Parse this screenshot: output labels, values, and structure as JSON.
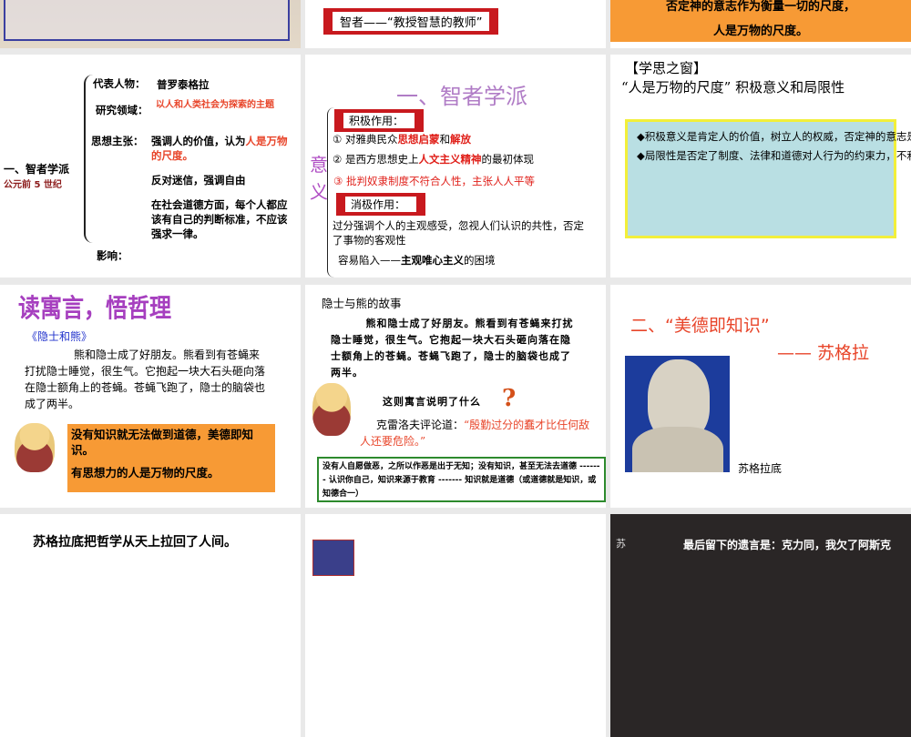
{
  "slides": {
    "s0": {
      "kind": "photo"
    },
    "s1": {
      "banner": "智者——“教授智慧的教师”"
    },
    "s2": {
      "line1": "否定神的意志作为衡量一切的尺度，",
      "line2": "人是万物的尺度。"
    },
    "s3": {
      "title": "一、智者学派",
      "era": "公元前 5 世纪",
      "rep_label": "代表人物：",
      "rep": "普罗泰格拉",
      "field_label": "研究领域：",
      "field": "以人和人类社会为探索的主题",
      "idea_label": "思想主张：",
      "idea1a": "强调人的价值，认为",
      "idea1b": "人是万物的尺度。",
      "idea2": "反对迷信，强调自由",
      "idea3": "在社会道德方面，每个人都应该有自己的判断标准，不应该强求一律。",
      "influence_label": "影响："
    },
    "s4": {
      "title": "一、智者学派",
      "side": "意义",
      "pos_label": "积极作用：",
      "p1a": "① 对雅典民众",
      "p1b": "思想启蒙",
      "p1c": "和",
      "p1d": "解放",
      "p2a": "② 是西方思想史上",
      "p2b": "人文主义精神",
      "p2c": "的最初体现",
      "p3": "③ 批判奴隶制度不符合人性，主张人人平等",
      "neg_label": "消极作用：",
      "n1": "过分强调个人的主观感受，忽视人们认识的共性，否定了事物的客观性",
      "n2a": "容易陷入——",
      "n2b": "主观唯心主义",
      "n2c": "的困境"
    },
    "s5": {
      "head": "【学思之窗】",
      "sub": "“人是万物的尺度” 积极意义和局限性",
      "b1": "◆积极意义是肯定人的价值，树立人的权威，否定神的意志是衡量一切的标准，体现了西方人文主义的本质。",
      "b2": "◆局限性是否定了制度、法律和道德对人行为的约束力，不利于建立正常的社会秩序和社会公德。"
    },
    "s6": {
      "title": "读寓言，悟哲理",
      "story_title": "《隐士和熊》",
      "story": "熊和隐士成了好朋友。熊看到有苍蝇来打扰隐士睡觉，很生气。它抱起一块大石头砸向落在隐士额角上的苍蝇。苍蝇飞跑了，隐士的脑袋也成了两半。",
      "box1": "没有知识就无法做到道德，美德即知识。",
      "box2": "有思想力的人是万物的尺度。"
    },
    "s7": {
      "title": "隐士与熊的故事",
      "story": "熊和隐士成了好朋友。熊看到有苍蝇来打扰隐士睡觉，很生气。它抱起一块大石头砸向落在隐士额角上的苍蝇。苍蝇飞跑了，隐士的脑袋也成了两半。",
      "question": "这则寓言说明了什么",
      "quote_a": "克雷洛夫评论道：",
      "quote_b": "“殷勤过分的蠢才比任何敌人还要危险。”",
      "box": "没有人自愿做恶，之所以作恶是出于无知；没有知识，甚至无法去道德 ------- 认识你自己，知识来源于教育 ------- 知识就是道德（或道德就是知识，或知德合一）"
    },
    "s8": {
      "title": "二、“美德即知识”",
      "author": "—— 苏格拉",
      "caption": "苏格拉底"
    },
    "s9": {
      "text": "苏格拉底把哲学从天上拉回了人间。"
    },
    "s10": {
      "kind": "image"
    },
    "s11": {
      "mark": "苏",
      "text": "最后留下的遗言是：克力同，我欠了阿斯克"
    }
  },
  "colors": {
    "accent_red": "#e8452a",
    "orange": "#f79a35",
    "purple": "#b04fc4",
    "teal_box": "#b9dfe3"
  }
}
